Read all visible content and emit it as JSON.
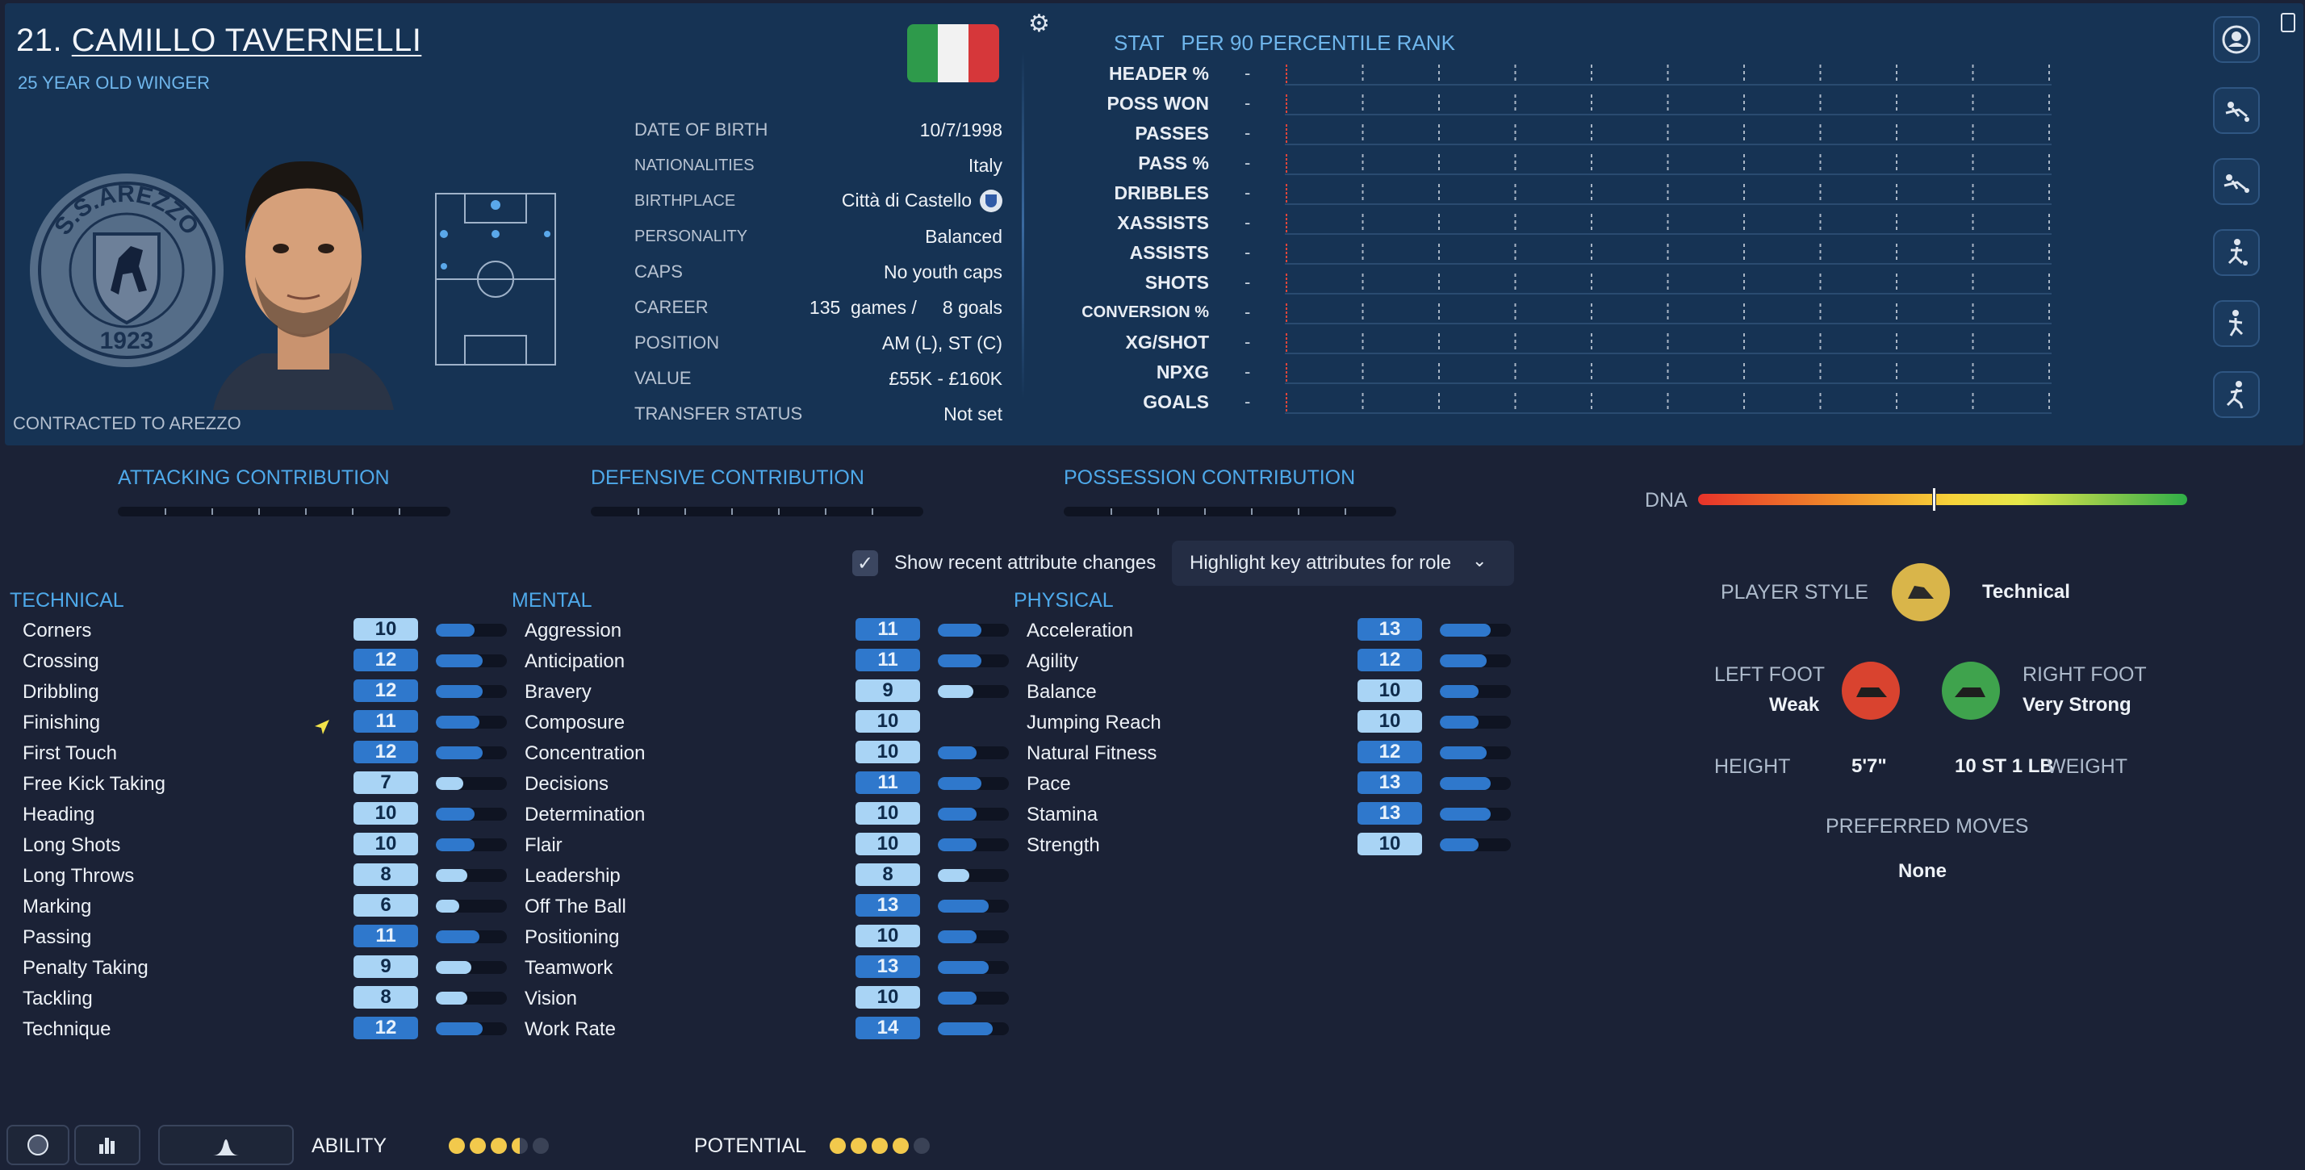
{
  "player": {
    "number": "21.",
    "name": "CAMILLO TAVERNELLI",
    "subtitle": "25 YEAR OLD WINGER",
    "contracted": "CONTRACTED TO AREZZO",
    "crest_text_top": "S.S.AREZZO",
    "crest_year": "1923"
  },
  "info": [
    {
      "label": "DATE OF BIRTH",
      "value": "10/7/1998"
    },
    {
      "label": "NATIONALITIES",
      "value": "Italy"
    },
    {
      "label": "BIRTHPLACE",
      "value": "Città di Castello"
    },
    {
      "label": "PERSONALITY",
      "value": "Balanced"
    },
    {
      "label": "CAPS",
      "value": "No youth caps"
    },
    {
      "label": "CAREER",
      "value": "135  games /     8 goals"
    },
    {
      "label": "POSITION",
      "value": "AM (L), ST (C)"
    },
    {
      "label": "VALUE",
      "value": "£55K - £160K"
    },
    {
      "label": "TRANSFER STATUS",
      "value": "Not set"
    }
  ],
  "stats_panel": {
    "stat_label": "STAT",
    "percentile_label": "PER 90 PERCENTILE RANK",
    "rows": [
      {
        "label": "HEADER %",
        "value": "-"
      },
      {
        "label": "POSS WON",
        "value": "-"
      },
      {
        "label": "PASSES",
        "value": "-"
      },
      {
        "label": "PASS %",
        "value": "-"
      },
      {
        "label": "DRIBBLES",
        "value": "-"
      },
      {
        "label": "XASSISTS",
        "value": "-"
      },
      {
        "label": "ASSISTS",
        "value": "-"
      },
      {
        "label": "SHOTS",
        "value": "-"
      },
      {
        "label": "CONVERSION %",
        "value": "-"
      },
      {
        "label": "XG/SHOT",
        "value": "-"
      },
      {
        "label": "NPXG",
        "value": "-"
      },
      {
        "label": "GOALS",
        "value": "-"
      }
    ]
  },
  "contributions": {
    "attacking": "ATTACKING CONTRIBUTION",
    "defensive": "DEFENSIVE CONTRIBUTION",
    "possession": "POSSESSION CONTRIBUTION"
  },
  "dna": {
    "label": "DNA",
    "level": 0.52
  },
  "controls": {
    "recent_changes_label": "Show recent attribute changes",
    "recent_changes_checked": true,
    "highlight_label": "Highlight key attributes for role"
  },
  "attributes": {
    "technical": {
      "title": "TECHNICAL",
      "items": [
        {
          "name": "Corners",
          "value": "10"
        },
        {
          "name": "Crossing",
          "value": "12"
        },
        {
          "name": "Dribbling",
          "value": "12"
        },
        {
          "name": "Finishing",
          "value": "11"
        },
        {
          "name": "First Touch",
          "value": "12"
        },
        {
          "name": "Free Kick Taking",
          "value": "7"
        },
        {
          "name": "Heading",
          "value": "10"
        },
        {
          "name": "Long Shots",
          "value": "10"
        },
        {
          "name": "Long Throws",
          "value": "8"
        },
        {
          "name": "Marking",
          "value": "6"
        },
        {
          "name": "Passing",
          "value": "11"
        },
        {
          "name": "Penalty Taking",
          "value": "9"
        },
        {
          "name": "Tackling",
          "value": "8"
        },
        {
          "name": "Technique",
          "value": "12"
        }
      ]
    },
    "mental": {
      "title": "MENTAL",
      "items": [
        {
          "name": "Aggression",
          "value": "11"
        },
        {
          "name": "Anticipation",
          "value": "11"
        },
        {
          "name": "Bravery",
          "value": "9"
        },
        {
          "name": "Composure",
          "value": "10"
        },
        {
          "name": "Concentration",
          "value": "10"
        },
        {
          "name": "Decisions",
          "value": "11"
        },
        {
          "name": "Determination",
          "value": "10"
        },
        {
          "name": "Flair",
          "value": "10"
        },
        {
          "name": "Leadership",
          "value": "8"
        },
        {
          "name": "Off The Ball",
          "value": "13"
        },
        {
          "name": "Positioning",
          "value": "10"
        },
        {
          "name": "Teamwork",
          "value": "13"
        },
        {
          "name": "Vision",
          "value": "10"
        },
        {
          "name": "Work Rate",
          "value": "14"
        }
      ]
    },
    "physical": {
      "title": "PHYSICAL",
      "items": [
        {
          "name": "Acceleration",
          "value": "13"
        },
        {
          "name": "Agility",
          "value": "12"
        },
        {
          "name": "Balance",
          "value": "10"
        },
        {
          "name": "Jumping Reach",
          "value": "10"
        },
        {
          "name": "Natural Fitness",
          "value": "12"
        },
        {
          "name": "Pace",
          "value": "13"
        },
        {
          "name": "Stamina",
          "value": "13"
        },
        {
          "name": "Strength",
          "value": "10"
        }
      ]
    }
  },
  "profile": {
    "player_style_label": "PLAYER STYLE",
    "player_style_value": "Technical",
    "left_foot_label": "LEFT FOOT",
    "left_foot_value": "Weak",
    "right_foot_label": "RIGHT FOOT",
    "right_foot_value": "Very Strong",
    "height_label": "HEIGHT",
    "height_value": "5'7\"",
    "weight_label": "WEIGHT",
    "weight_value": "10 ST 1 LB",
    "preferred_moves_label": "PREFERRED MOVES",
    "preferred_moves_value": "None"
  },
  "footer": {
    "ability_label": "ABILITY",
    "ability_stars": 3.5,
    "potential_label": "POTENTIAL",
    "potential_stars": 4
  },
  "colors": {
    "panel": "#163354",
    "accent": "#4ea9ea",
    "attr_low": "#a9d4f5",
    "attr_high": "#2f78cc",
    "bar_low": "#a9d4f5",
    "bar_high": "#2f78cc",
    "left_foot": "#d9432f",
    "right_foot": "#3fa34d",
    "style_badge": "#d9b54a",
    "star": "#f2c94c"
  }
}
